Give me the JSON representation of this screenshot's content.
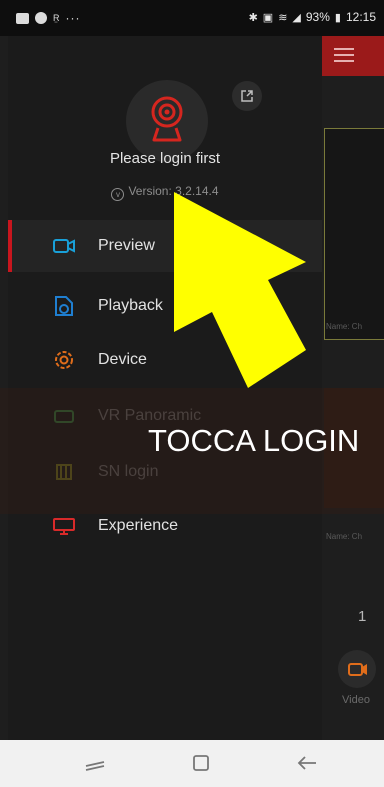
{
  "status_bar": {
    "left_icons": [
      "image-icon",
      "app-icon",
      "rx-indicator",
      "more-dots-icon"
    ],
    "rx_label": "R̤",
    "dots": "···",
    "battery_percent": "93%",
    "time": "12:15"
  },
  "drawer": {
    "login_prompt": "Please login first",
    "version_text": "Version: 3.2.14.4",
    "menu_items": [
      {
        "label": "Preview",
        "icon": "preview-icon",
        "color": "#19a0d8",
        "active": true
      },
      {
        "label": "Playback",
        "icon": "playback-icon",
        "color": "#1f7fd1",
        "active": false
      },
      {
        "label": "Device",
        "icon": "device-icon",
        "color": "#e06d1b",
        "active": false
      },
      {
        "label": "VR Panoramic",
        "icon": "vr-icon",
        "color": "#2e8c3a",
        "active": false
      },
      {
        "label": "SN login",
        "icon": "sn-icon",
        "color": "#7f8a1b",
        "active": false
      },
      {
        "label": "Experience",
        "icon": "experience-icon",
        "color": "#d82a2a",
        "active": false
      }
    ]
  },
  "overlay": {
    "instruction": "TOCCA LOGIN"
  },
  "background_app": {
    "page_number": "1",
    "caption_1": "Name: Ch",
    "caption_2": "Name: Ch",
    "video_label": "Video"
  },
  "colors": {
    "accent_red": "#c8161e",
    "arrow_yellow": "#ffff00"
  }
}
